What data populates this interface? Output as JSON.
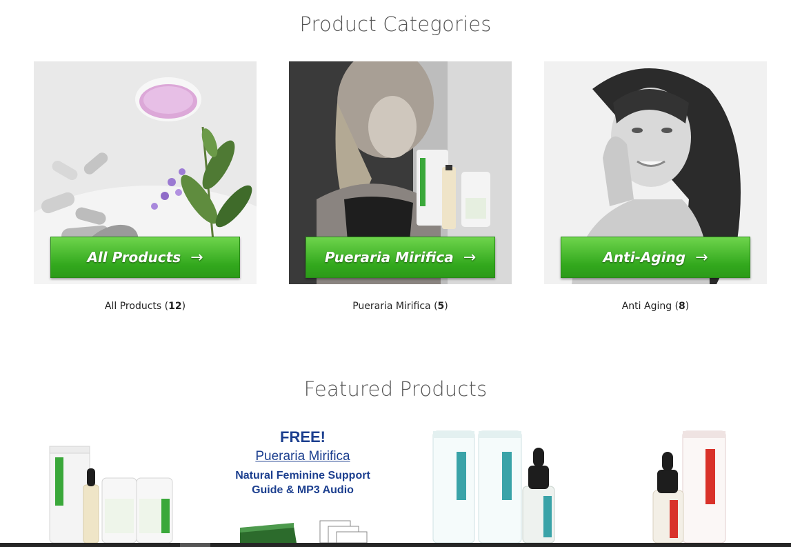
{
  "sections": {
    "categories_title": "Product Categories",
    "featured_title": "Featured Products"
  },
  "categories": [
    {
      "button_label": "All Products",
      "caption": "All Products",
      "count": "12"
    },
    {
      "button_label": "Pueraria Mirifica",
      "caption": "Pueraria Mirifica",
      "count": "5"
    },
    {
      "button_label": "Anti-Aging",
      "caption": "Anti Aging",
      "count": "8"
    }
  ],
  "arrow_glyph": "→",
  "promo": {
    "free": "FREE!",
    "link": "Pueraria Mirifica",
    "line1": "Natural Feminine Support",
    "line2": "Guide & MP3 Audio"
  },
  "colors": {
    "button_green": "#32a81d",
    "promo_blue": "#1c3f8f",
    "brand_green": "#3aa83a",
    "brand_teal": "#3aa3a8",
    "brand_red": "#d9322a"
  },
  "open_paren": "(",
  "close_paren": ")"
}
